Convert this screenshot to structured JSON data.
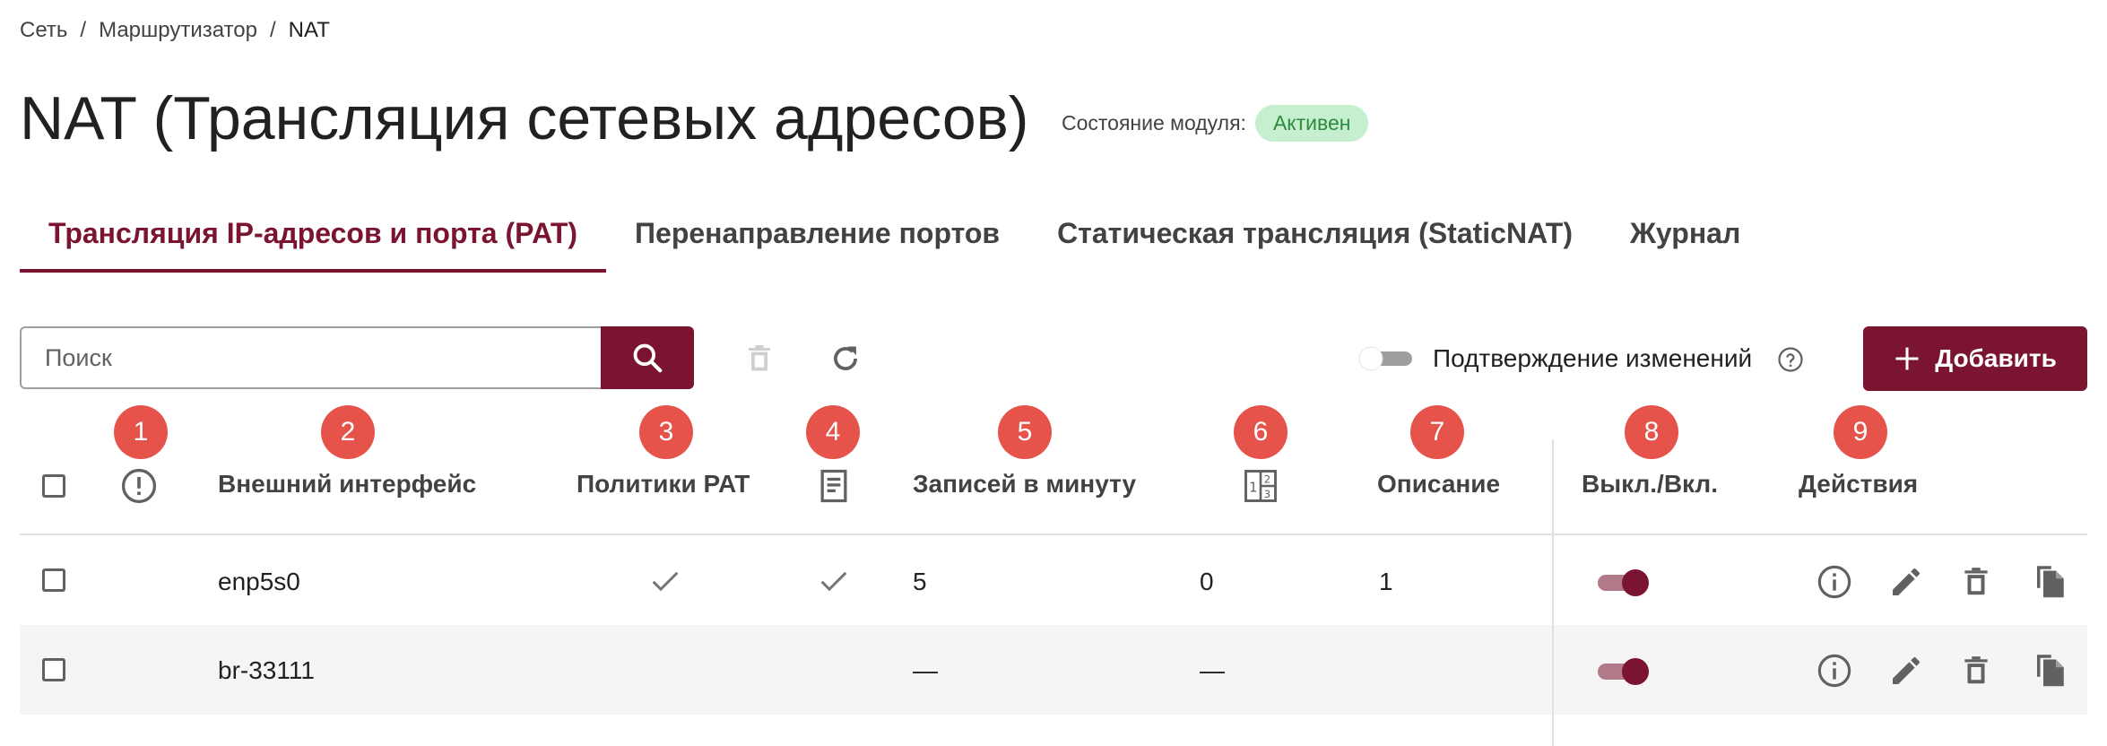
{
  "breadcrumb": {
    "items": [
      "Сеть",
      "Маршрутизатор"
    ],
    "current": "NAT"
  },
  "header": {
    "title": "NAT (Трансляция сетевых адресов)",
    "status_label": "Состояние модуля:",
    "status_value": "Активен",
    "status_color": "#2e8b3e"
  },
  "tabs": [
    {
      "label": "Трансляция IP-адресов и порта (PAT)",
      "active": true
    },
    {
      "label": "Перенаправление портов",
      "active": false
    },
    {
      "label": "Статическая трансляция (StaticNAT)",
      "active": false
    },
    {
      "label": "Журнал",
      "active": false
    }
  ],
  "toolbar": {
    "search_placeholder": "Поиск",
    "confirm_label": "Подтверждение изменений",
    "add_label": "Добавить"
  },
  "markers": [
    "1",
    "2",
    "3",
    "4",
    "5",
    "6",
    "7",
    "8",
    "9"
  ],
  "table": {
    "headers": {
      "external_interface": "Внешний интерфейс",
      "pat_policies": "Политики PAT",
      "records_per_minute": "Записей в минуту",
      "description": "Описание",
      "on_off": "Выкл./Вкл.",
      "actions": "Действия"
    },
    "rows": [
      {
        "interface": "enp5s0",
        "pat": true,
        "log": true,
        "records": "5",
        "order": "0",
        "description": "1",
        "enabled": true
      },
      {
        "interface": "br-33111",
        "pat": false,
        "log": false,
        "records": "—",
        "order": "—",
        "description": "",
        "enabled": true
      }
    ]
  },
  "colors": {
    "brand": "#7b1430",
    "marker": "#e5534b",
    "badge_bg": "#c6efcf"
  }
}
